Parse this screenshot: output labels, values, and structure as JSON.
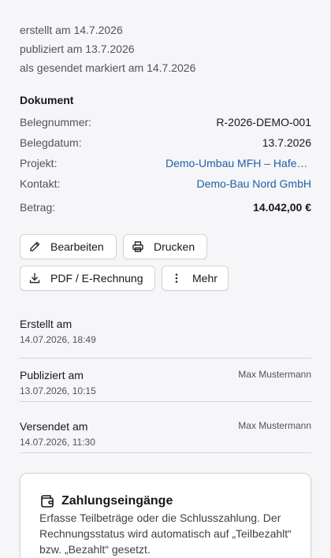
{
  "history": [
    "erstellt am 14.7.2026",
    "publiziert am 13.7.2026",
    "als gesendet markiert am 14.7.2026"
  ],
  "document": {
    "title": "Dokument",
    "fields": [
      {
        "label": "Belegnummer:",
        "value": "R-2026-DEMO-001"
      },
      {
        "label": "Belegdatum:",
        "value": "13.7.2026"
      },
      {
        "label": "Projekt:",
        "value": "Demo-Umbau MFH – Hafenstraße"
      },
      {
        "label": "Kontakt:",
        "value": "Demo-Bau Nord GmbH"
      },
      {
        "label": "Betrag:",
        "value": "14.042,00 €"
      }
    ]
  },
  "actions": {
    "edit": "Bearbeiten",
    "print": "Drucken",
    "pdf": "PDF / E-Rechnung",
    "more": "Mehr"
  },
  "timeline": [
    {
      "title": "Erstellt am",
      "date": "14.07.2026, 18:49",
      "user": ""
    },
    {
      "title": "Publiziert am",
      "date": "13.07.2026, 10:15",
      "user": "Max Mustermann"
    },
    {
      "title": "Versendet am",
      "date": "14.07.2026, 11:30",
      "user": "Max Mustermann"
    }
  ],
  "payments": {
    "title": "Zahlungseingänge",
    "description": "Erfasse Teilbeträge oder die Schlusszahlung. Der Rechnungsstatus wird automatisch auf „Teilbezahlt“ bzw. „Bezahlt“ gesetzt."
  },
  "colors": {
    "link": "#1f5fa6",
    "background": "#f6f6f8"
  }
}
